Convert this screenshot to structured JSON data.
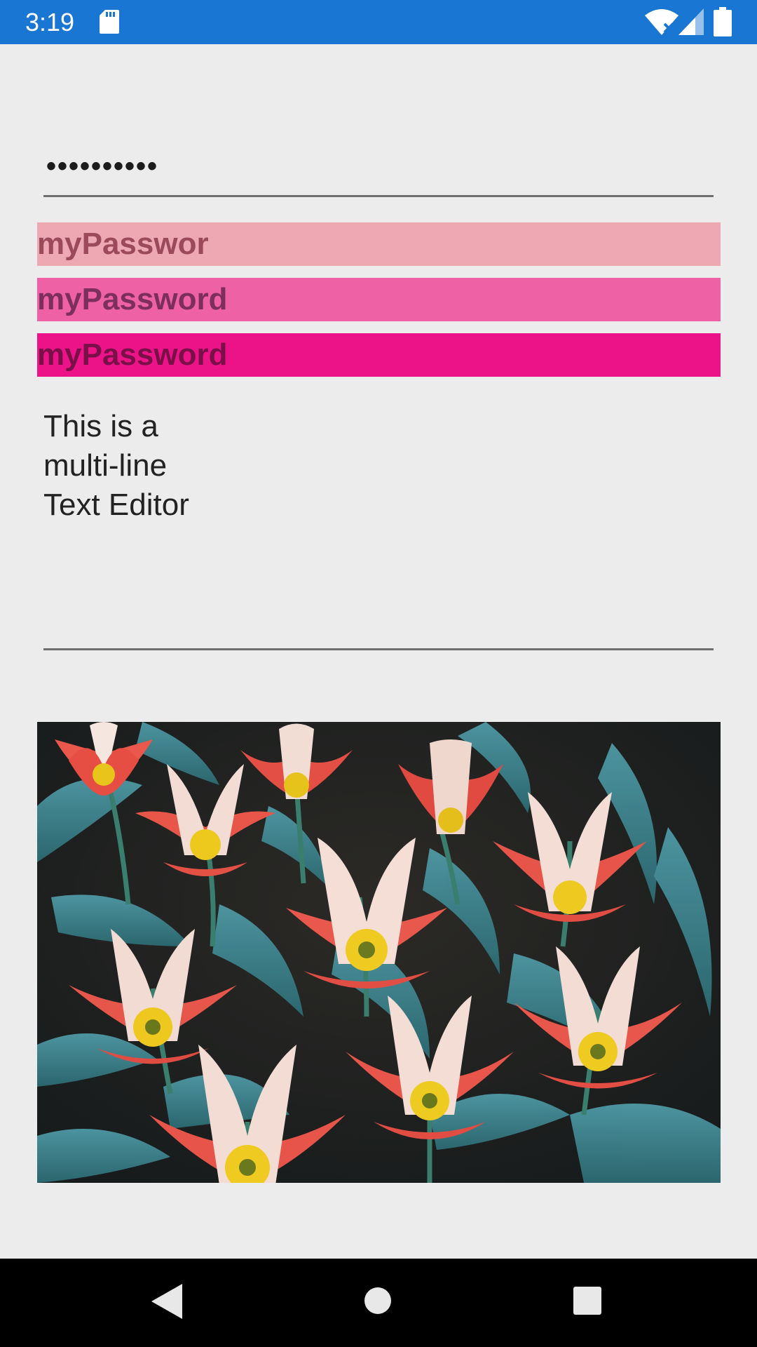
{
  "status_bar": {
    "time": "3:19",
    "icons": [
      "sd-card-icon",
      "wifi-icon",
      "signal-icon",
      "battery-icon"
    ],
    "color": "#1976d2"
  },
  "password_entry": {
    "masked_value": "••••••••••"
  },
  "labels": [
    {
      "text": "myPasswor",
      "background": "#eda8b3"
    },
    {
      "text": "myPassword",
      "background": "#ee62a5"
    },
    {
      "text": "myPassword",
      "background": "#ec1388"
    }
  ],
  "editor": {
    "lines": [
      "This is a",
      "multi-line",
      "Text Editor"
    ]
  },
  "image": {
    "icon": "tulips-image"
  },
  "nav_bar": {
    "icons": [
      "back-icon",
      "home-icon",
      "recents-icon"
    ]
  }
}
